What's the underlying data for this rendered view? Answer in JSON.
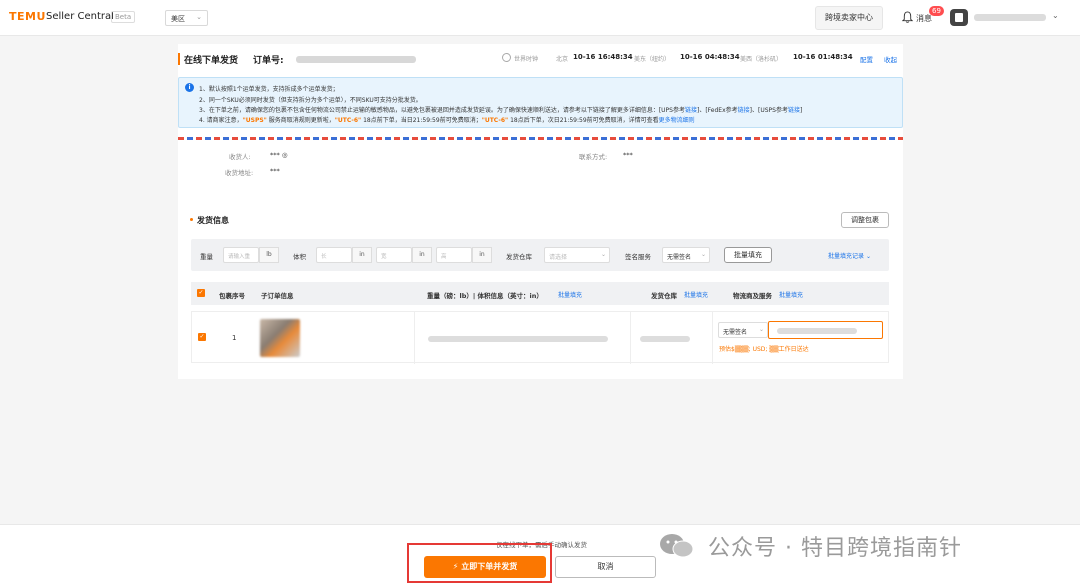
{
  "topbar": {
    "logo": "TEMU",
    "logo_sub": "Seller Central",
    "beta": "Beta",
    "region": "美区",
    "cross_border_btn": "跨境卖家中心",
    "messages_label": "消息",
    "messages_badge": "69"
  },
  "header": {
    "title": "在线下单发货",
    "order_label": "订单号:",
    "world_time": "世界时钟",
    "zones": [
      {
        "name": "北京",
        "time": "10-16 16:48:34"
      },
      {
        "name": "美东（纽约）",
        "time": "10-16 04:48:34"
      },
      {
        "name": "美西（洛杉矶）",
        "time": "10-16 01:48:34"
      }
    ],
    "config_link": "配置",
    "collapse_link": "收起"
  },
  "notice": {
    "line1": "1、默认按照1个运单发货，支持拆成多个运单发货；",
    "line2": "2、同一个SKU必须同时发货（但支持拆分为多个运单），不同SKU可支持分批发货。",
    "line3_a": "3、在下单之前，请确保您的包裹不包含任何物流公司禁止运输的敏感物品，以避免包裹被退回并造成发货延误。为了确保快速顺利送达，请参考以下链接了解更多详细信息：[UPS参考",
    "line3_link1": "链接",
    "line3_b": "]、[FedEx参考",
    "line3_link2": "链接",
    "line3_c": "]、[USPS参考",
    "line3_link3": "链接",
    "line3_d": "]",
    "line4_a": "4. 请商家注意，",
    "line4_usps": "\"USPS\"",
    "line4_b": "服务商取消规则更新啦，",
    "line4_utc1": "\"UTC-6\"",
    "line4_c": "18点前下单，当日21:59:59前可免费取消；",
    "line4_utc2": "\"UTC-6\"",
    "line4_d": "18点后下单，次日21:59:59前可免费取消，详情可查看",
    "line4_link": "更多物流细则"
  },
  "address": {
    "receiver_label": "收货人:",
    "receiver_value": "*** ◎",
    "contact_label": "联系方式:",
    "contact_value": "***",
    "address_label": "收货地址:",
    "address_value": "***"
  },
  "shipping": {
    "title": "发货信息",
    "adjust_btn": "调整包裹",
    "filter": {
      "weight_label": "重量",
      "weight_placeholder": "请输入重",
      "weight_unit": "lb",
      "volume_label": "体积",
      "length_ph": "长",
      "width_ph": "宽",
      "height_ph": "高",
      "dim_unit": "in",
      "warehouse_label": "发货仓库",
      "warehouse_ph": "请选择",
      "signature_label": "签名服务",
      "signature_value": "无需签名",
      "bulk_fill_btn": "批量填充",
      "bulk_record": "批量填充记录"
    },
    "table": {
      "col_seq": "包裹序号",
      "col_sub": "子订单信息",
      "col_dims": "重量（磅：lb）| 体积信息（英寸：in）",
      "col_dims_link": "批量填充",
      "col_wh": "发货仓库",
      "col_wh_link": "批量填充",
      "col_carrier": "物流商及服务",
      "col_carrier_link": "批量填充",
      "rows": [
        {
          "seq": "1",
          "signature": "无需签名",
          "estimate": "预估$▒▒▒; USD; ▒▒工作日送达"
        }
      ]
    }
  },
  "footer": {
    "note": "仅在线下单，需后手动确认发货",
    "submit": "立即下单并发货",
    "cancel": "取消"
  },
  "watermark": "公众号 · 特目跨境指南针",
  "colors": {
    "accent": "#fb7701",
    "link": "#1a73e8",
    "badge": "#ff4d4f"
  }
}
